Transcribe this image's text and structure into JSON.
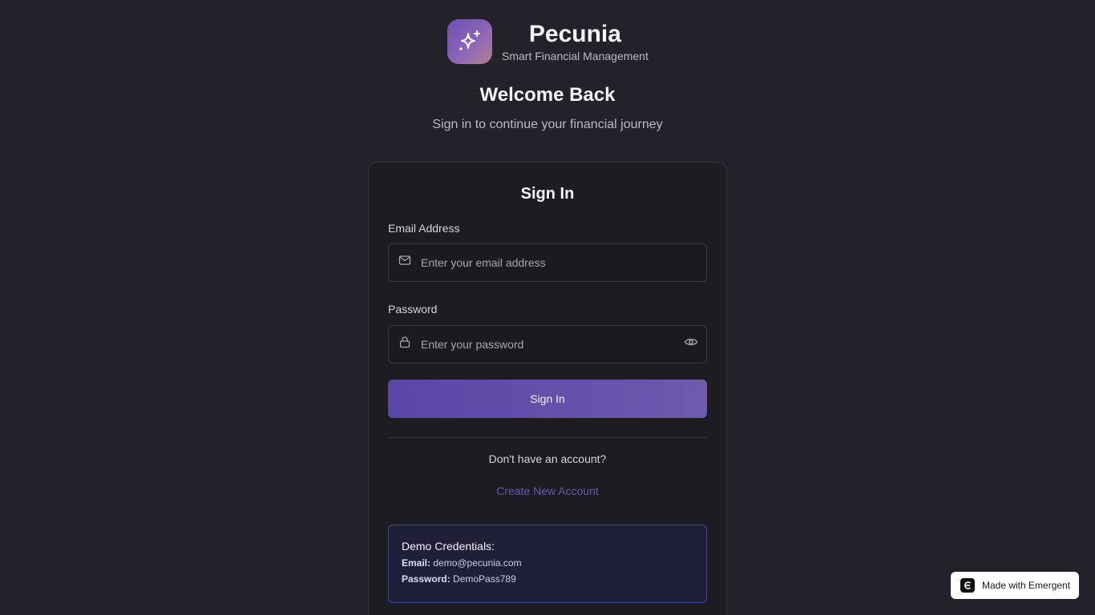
{
  "brand": {
    "name": "Pecunia",
    "tagline": "Smart Financial Management",
    "logo_icon": "sparkles-icon",
    "accent": "#6b4fb0"
  },
  "welcome": {
    "title": "Welcome Back",
    "subtitle": "Sign in to continue your financial journey"
  },
  "card": {
    "title": "Sign In",
    "email": {
      "label": "Email Address",
      "placeholder": "Enter your email address",
      "value": "",
      "icon": "mail-icon"
    },
    "password": {
      "label": "Password",
      "placeholder": "Enter your password",
      "value": "",
      "icon": "lock-icon",
      "toggle_icon": "eye-icon"
    },
    "submit_label": "Sign In",
    "no_account_text": "Don't have an account?",
    "create_account_label": "Create New Account",
    "demo": {
      "title": "Demo Credentials:",
      "email_key": "Email:",
      "email_value": "demo@pecunia.com",
      "password_key": "Password:",
      "password_value": "DemoPass789"
    }
  },
  "badge": {
    "label": "Made with Emergent"
  }
}
